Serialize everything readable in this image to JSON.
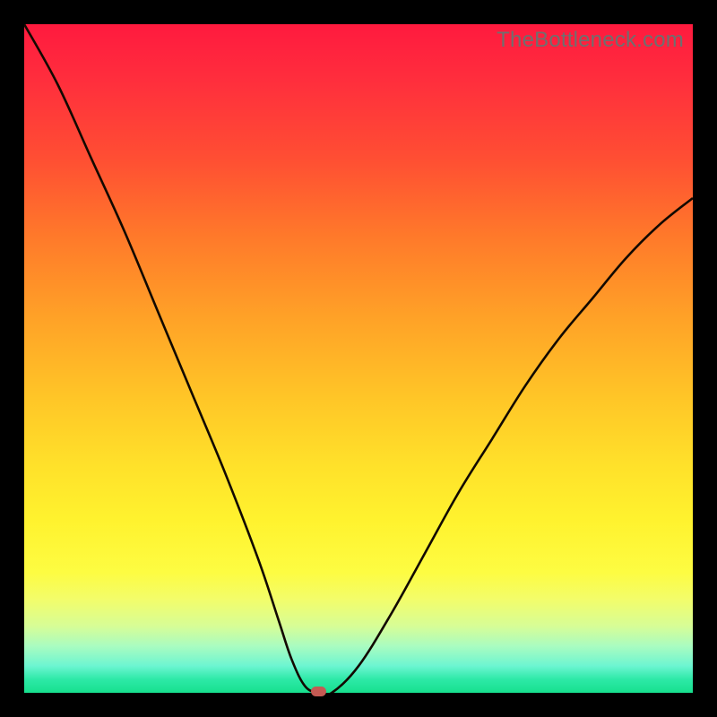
{
  "watermark": "TheBottleneck.com",
  "colors": {
    "frame": "#000000",
    "curve": "#120900",
    "marker": "#c45a53",
    "watermark": "#6f6f6f"
  },
  "chart_data": {
    "type": "line",
    "title": "",
    "xlabel": "",
    "ylabel": "",
    "xlim": [
      0,
      100
    ],
    "ylim": [
      0,
      100
    ],
    "grid": false,
    "legend": false,
    "annotations": [
      "TheBottleneck.com"
    ],
    "series": [
      {
        "name": "bottleneck-curve",
        "x": [
          0,
          5,
          10,
          15,
          20,
          25,
          30,
          35,
          38,
          40,
          42,
          44,
          46,
          50,
          55,
          60,
          65,
          70,
          75,
          80,
          85,
          90,
          95,
          100
        ],
        "values": [
          100,
          91,
          80,
          69,
          57,
          45,
          33,
          20,
          11,
          5,
          1,
          0,
          0,
          4,
          12,
          21,
          30,
          38,
          46,
          53,
          59,
          65,
          70,
          74
        ]
      }
    ],
    "marker": {
      "x": 44,
      "y": 0
    },
    "gradient_stops": [
      {
        "pos": 0.0,
        "color": "#ff1a3e"
      },
      {
        "pos": 0.5,
        "color": "#ffc627"
      },
      {
        "pos": 0.82,
        "color": "#fdfc42"
      },
      {
        "pos": 1.0,
        "color": "#17e08e"
      }
    ]
  }
}
